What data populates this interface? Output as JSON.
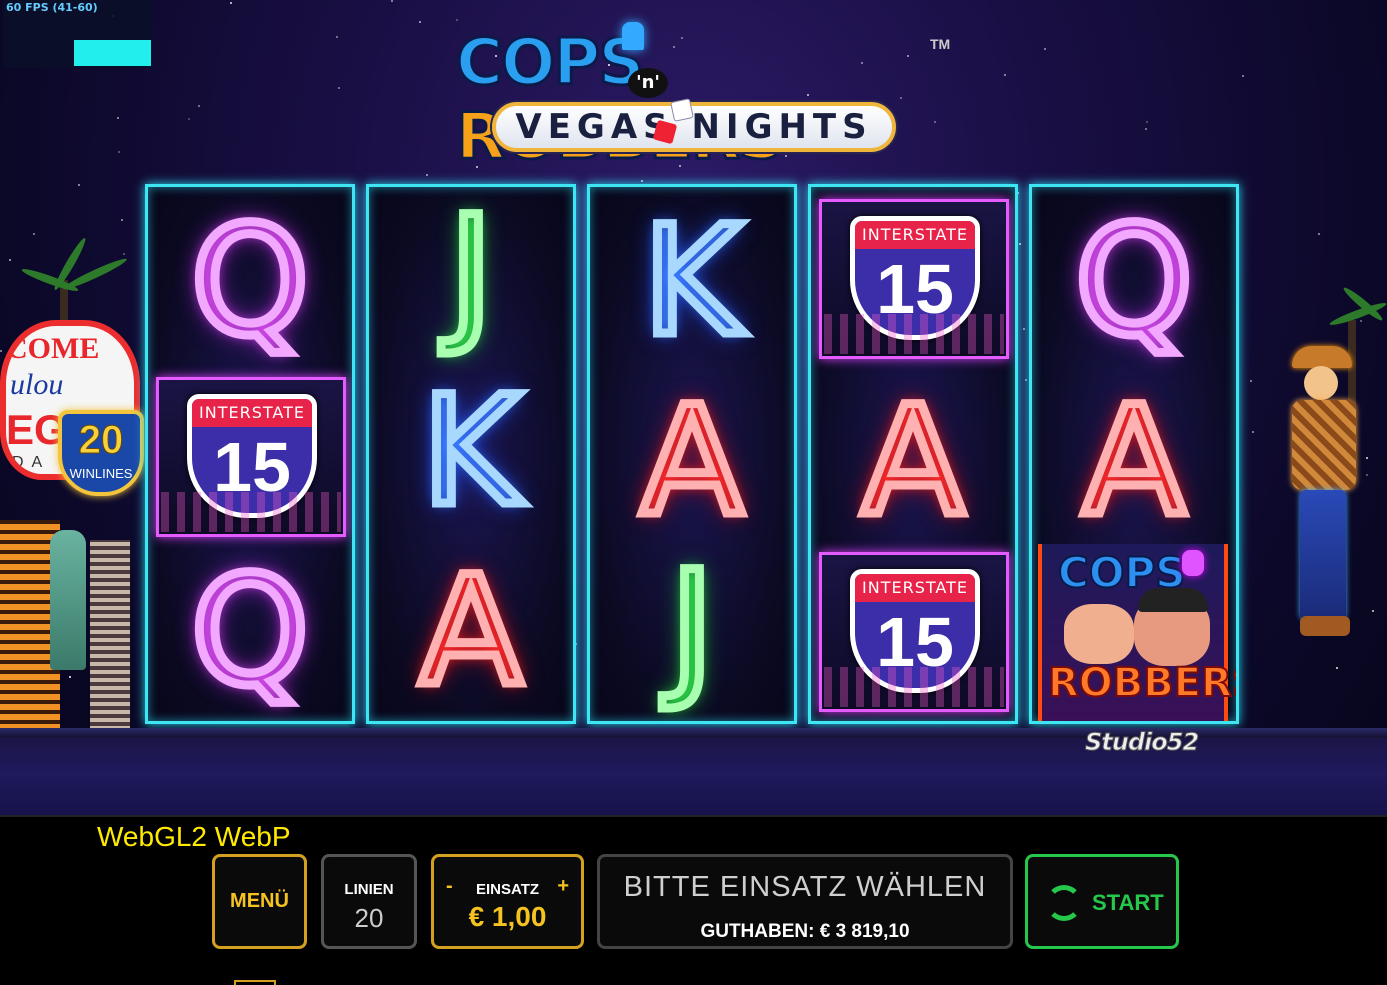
{
  "debug": {
    "fps": "60 FPS (41-60)",
    "renderer": "WebGL2  WebP"
  },
  "logo": {
    "cops": "COPS",
    "n": "'n'",
    "robbers": "ROBBERS",
    "tm": "TM",
    "subtitle": "VEGAS NIGHTS"
  },
  "scenery": {
    "sign_line1": "COME",
    "sign_line2": "ulou",
    "sign_line3": "EG",
    "sign_line4": "DA",
    "winlines_number": "20",
    "winlines_label": "WINLINES"
  },
  "reels": [
    {
      "symbols": [
        "Q",
        "INTERSTATE 15",
        "Q"
      ]
    },
    {
      "symbols": [
        "J",
        "K",
        "A"
      ]
    },
    {
      "symbols": [
        "K",
        "A",
        "J"
      ]
    },
    {
      "symbols": [
        "INTERSTATE 15",
        "A",
        "INTERSTATE 15"
      ]
    },
    {
      "symbols": [
        "Q",
        "A",
        "COPS ROBBERS"
      ]
    }
  ],
  "interstate": {
    "label": "INTERSTATE",
    "number": "15"
  },
  "cops_robbers_symbol": {
    "top": "COPS",
    "bottom": "ROBBERS"
  },
  "studio": "Studio52",
  "controls": {
    "menu_label": "MENÜ",
    "lines_label": "LINIEN",
    "lines_value": "20",
    "bet_label": "EINSATZ",
    "bet_value": "€ 1,00",
    "bet_minus": "-",
    "bet_plus": "+",
    "message": "BITTE EINSATZ WÄHLEN",
    "balance": "GUTHABEN: € 3 819,10",
    "start_label": "START"
  },
  "colors": {
    "reel_border": "#3ee6f4",
    "gold": "#d4a020",
    "start_green": "#25c84a"
  }
}
